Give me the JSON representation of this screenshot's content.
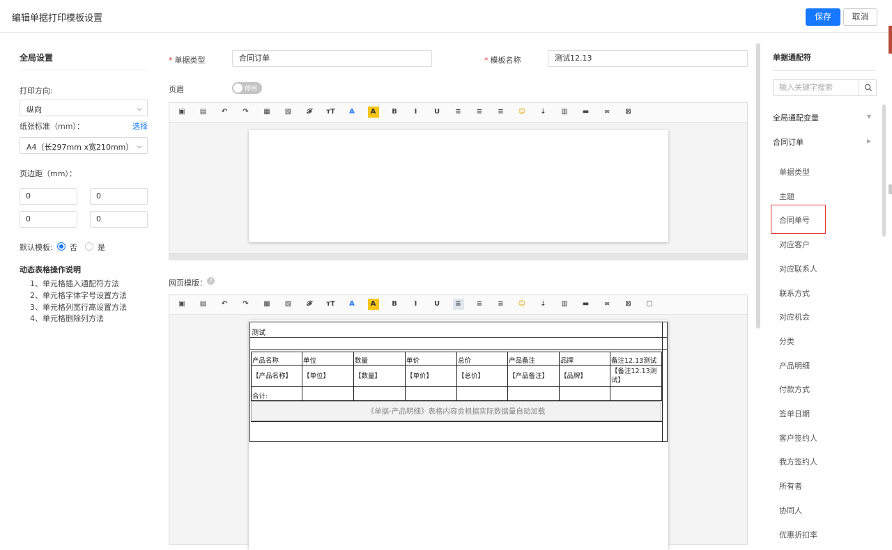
{
  "header": {
    "title": "编辑单据打印模板设置",
    "save_label": "保存",
    "cancel_label": "取消"
  },
  "global_settings": {
    "title": "全局设置",
    "print_direction_label": "打印方向:",
    "print_direction_value": "纵向",
    "paper_label": "纸张标准（mm）：",
    "paper_choose": "选择",
    "paper_value": "A4（长297mm x宽210mm）",
    "margin_label": "页边距（mm）：",
    "margins": [
      "0",
      "0",
      "0",
      "0"
    ],
    "default_template_label": "默认模板:",
    "default_no": "否",
    "default_yes": "是",
    "default_selected": "否",
    "instructions_title": "动态表格操作说明",
    "instructions": [
      "1、单元格插入通配符方法",
      "2、单元格字体字号设置方法",
      "3、单元格列宽行高设置方法",
      "4、单元格删除列方法"
    ]
  },
  "form": {
    "doc_type_label": "单据类型",
    "doc_type_value": "合同订单",
    "template_name_label": "模板名称",
    "template_name_value": "测试12.13",
    "header_label": "页眉",
    "header_toggle_text": "停用",
    "web_template_label": "网页模版："
  },
  "template_table": {
    "title": "测试",
    "headers": [
      "产品名称",
      "单位",
      "数量",
      "单价",
      "总价",
      "产品备注",
      "品牌",
      "备注12.13测试"
    ],
    "row": [
      "【产品名称】",
      "【单位】",
      "【数量】",
      "【单价】",
      "【总价】",
      "【产品备注】",
      "【品牌】",
      "【备注12.13测试】"
    ],
    "total_label": "合计:",
    "auto_note": "《单据-产品明细》表格内容会根据实际数据量自动加载"
  },
  "wildcards": {
    "title": "单据通配符",
    "search_placeholder": "输入关键字搜索",
    "groups": [
      "全局通配变量",
      "合同订单"
    ],
    "items": [
      "单据类型",
      "主题",
      "合同单号",
      "对应客户",
      "对应联系人",
      "联系方式",
      "对应机会",
      "分类",
      "产品明细",
      "付款方式",
      "签单日期",
      "客户签约人",
      "我方签约人",
      "所有者",
      "协同人",
      "优惠折扣率"
    ],
    "highlighted_item": "合同单号"
  }
}
